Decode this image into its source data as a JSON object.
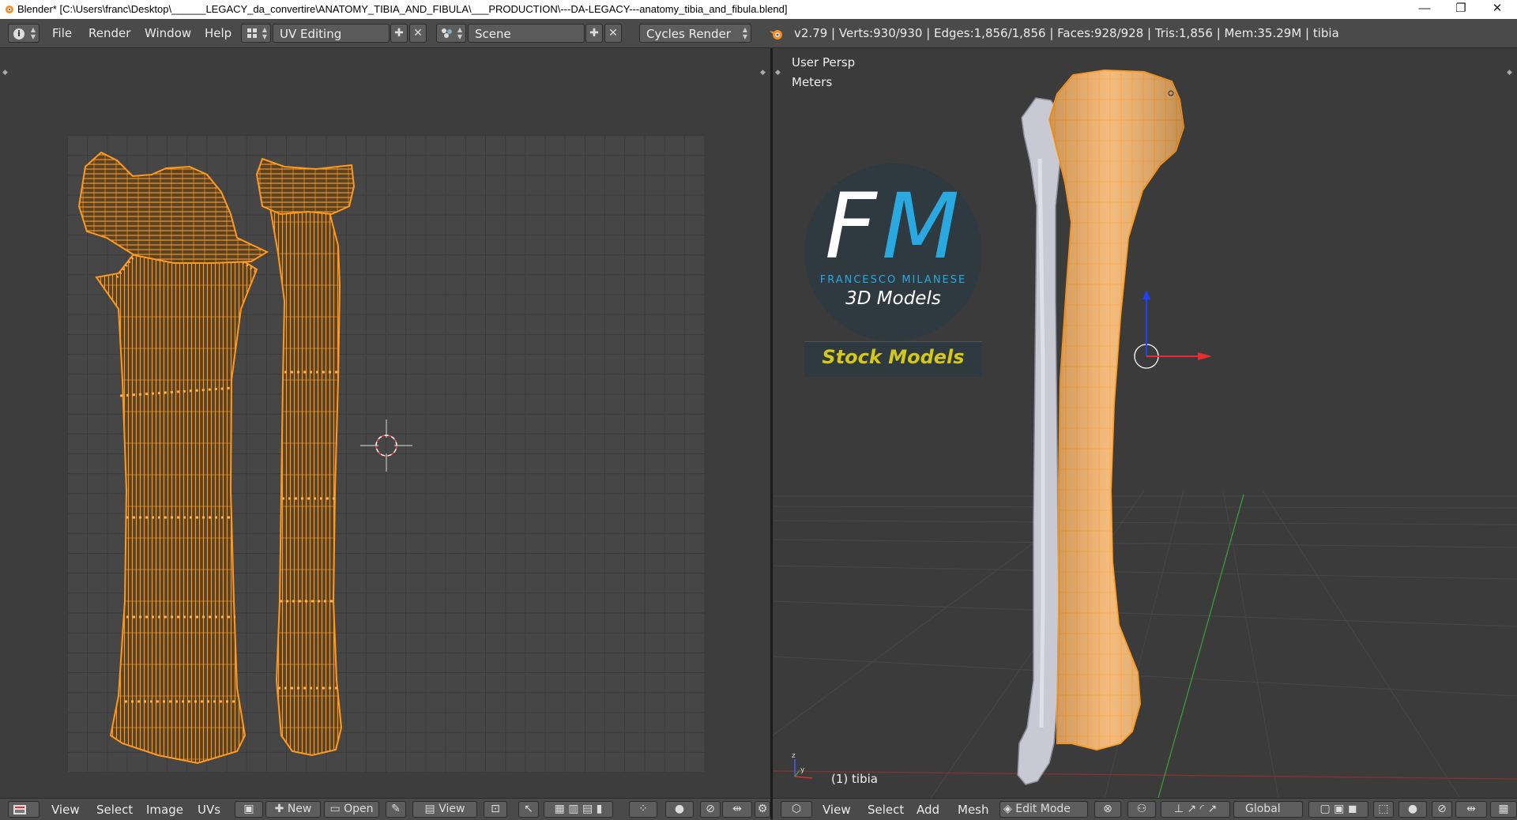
{
  "window": {
    "title": "Blender* [C:\\Users\\franc\\Desktop\\______LEGACY_da_convertire\\ANATOMY_TIBIA_AND_FIBULA\\___PRODUCTION\\---DA-LEGACY---anatomy_tibia_and_fibula.blend]",
    "minimize": "—",
    "restore": "❐",
    "close": "✕"
  },
  "menubar": {
    "info_icon": "i",
    "menus": [
      "File",
      "Render",
      "Window",
      "Help"
    ],
    "screen_layout": "UV Editing",
    "scene": "Scene",
    "render_engine": "Cycles Render",
    "stats": "v2.79 | Verts:930/930 | Edges:1,856/1,856 | Faces:928/928 | Tris:1,856 | Mem:35.29M | tibia"
  },
  "view3d": {
    "perspective": "User Persp",
    "units": "Meters",
    "object_label": "(1) tibia"
  },
  "watermark": {
    "logo_letters_f": "F",
    "logo_letters_m": "M",
    "brand": "FRANCESCO MILANESE",
    "tagline": "3D Models",
    "badge": "Stock Models"
  },
  "uv_header": {
    "menus": [
      "View",
      "Select",
      "Image",
      "UVs"
    ],
    "new_label": "New",
    "open_label": "Open",
    "view_label": "View"
  },
  "view3d_header": {
    "menus": [
      "View",
      "Select",
      "Add",
      "Mesh"
    ],
    "mode": "Edit Mode",
    "orientation": "Global"
  },
  "colors": {
    "mesh_orange": "#ff9a1f",
    "bone_grey": "#c9c9d4",
    "logo_blue": "#29a9e0",
    "badge_yellow": "#d4c81a",
    "axis_red": "#e03030",
    "axis_blue": "#2040ff",
    "axis_green": "#3a9a3a"
  }
}
